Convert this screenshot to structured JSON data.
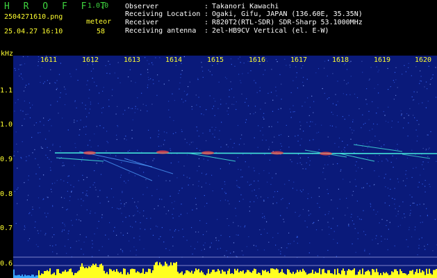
{
  "header": {
    "app_title": "H R O F F T",
    "app_version": "1.0.0",
    "file_name": "2504271610.png",
    "timestamp": "25.04.27 16:10",
    "meteor_label": "meteor",
    "meteor_count": "58",
    "info": [
      {
        "key": "Observer",
        "value": "Takanori Kawachi"
      },
      {
        "key": "Receiving Location",
        "value": "Ogaki, Gifu, JAPAN (136.60E, 35.35N)"
      },
      {
        "key": "Receiver",
        "value": "R820T2(RTL-SDR) SDR-Sharp 53.1000MHz"
      },
      {
        "key": "Receiving antenna",
        "value": "2el-HB9CV Vertical (el. E-W)"
      }
    ],
    "separator": ":"
  },
  "axis": {
    "unit": "kHz",
    "y_ticks": [
      "1.1",
      "1.0",
      "0.9",
      "0.8",
      "0.7",
      "0.6"
    ],
    "x_ticks": [
      "1611",
      "1612",
      "1613",
      "1614",
      "1615",
      "1616",
      "1617",
      "1618",
      "1619",
      "1620"
    ]
  },
  "colors": {
    "background": "#000000",
    "spectrogram_base": "#0a1a7a",
    "noise_light": "#3a6cff",
    "echo_line": "#47f0e0",
    "echo_hot": "#ff4a40",
    "level_bars": "#ffff20",
    "label": "#ffff30",
    "title": "#3fd43f"
  }
}
